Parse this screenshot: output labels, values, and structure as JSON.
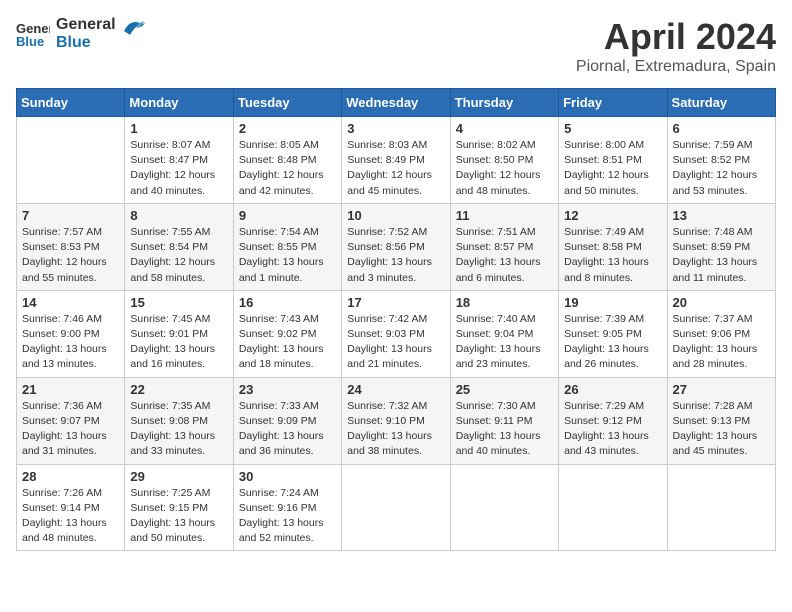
{
  "header": {
    "logo_general": "General",
    "logo_blue": "Blue",
    "title": "April 2024",
    "location": "Piornal, Extremadura, Spain"
  },
  "columns": [
    "Sunday",
    "Monday",
    "Tuesday",
    "Wednesday",
    "Thursday",
    "Friday",
    "Saturday"
  ],
  "weeks": [
    [
      {
        "day": "",
        "info": ""
      },
      {
        "day": "1",
        "info": "Sunrise: 8:07 AM\nSunset: 8:47 PM\nDaylight: 12 hours\nand 40 minutes."
      },
      {
        "day": "2",
        "info": "Sunrise: 8:05 AM\nSunset: 8:48 PM\nDaylight: 12 hours\nand 42 minutes."
      },
      {
        "day": "3",
        "info": "Sunrise: 8:03 AM\nSunset: 8:49 PM\nDaylight: 12 hours\nand 45 minutes."
      },
      {
        "day": "4",
        "info": "Sunrise: 8:02 AM\nSunset: 8:50 PM\nDaylight: 12 hours\nand 48 minutes."
      },
      {
        "day": "5",
        "info": "Sunrise: 8:00 AM\nSunset: 8:51 PM\nDaylight: 12 hours\nand 50 minutes."
      },
      {
        "day": "6",
        "info": "Sunrise: 7:59 AM\nSunset: 8:52 PM\nDaylight: 12 hours\nand 53 minutes."
      }
    ],
    [
      {
        "day": "7",
        "info": "Sunrise: 7:57 AM\nSunset: 8:53 PM\nDaylight: 12 hours\nand 55 minutes."
      },
      {
        "day": "8",
        "info": "Sunrise: 7:55 AM\nSunset: 8:54 PM\nDaylight: 12 hours\nand 58 minutes."
      },
      {
        "day": "9",
        "info": "Sunrise: 7:54 AM\nSunset: 8:55 PM\nDaylight: 13 hours\nand 1 minute."
      },
      {
        "day": "10",
        "info": "Sunrise: 7:52 AM\nSunset: 8:56 PM\nDaylight: 13 hours\nand 3 minutes."
      },
      {
        "day": "11",
        "info": "Sunrise: 7:51 AM\nSunset: 8:57 PM\nDaylight: 13 hours\nand 6 minutes."
      },
      {
        "day": "12",
        "info": "Sunrise: 7:49 AM\nSunset: 8:58 PM\nDaylight: 13 hours\nand 8 minutes."
      },
      {
        "day": "13",
        "info": "Sunrise: 7:48 AM\nSunset: 8:59 PM\nDaylight: 13 hours\nand 11 minutes."
      }
    ],
    [
      {
        "day": "14",
        "info": "Sunrise: 7:46 AM\nSunset: 9:00 PM\nDaylight: 13 hours\nand 13 minutes."
      },
      {
        "day": "15",
        "info": "Sunrise: 7:45 AM\nSunset: 9:01 PM\nDaylight: 13 hours\nand 16 minutes."
      },
      {
        "day": "16",
        "info": "Sunrise: 7:43 AM\nSunset: 9:02 PM\nDaylight: 13 hours\nand 18 minutes."
      },
      {
        "day": "17",
        "info": "Sunrise: 7:42 AM\nSunset: 9:03 PM\nDaylight: 13 hours\nand 21 minutes."
      },
      {
        "day": "18",
        "info": "Sunrise: 7:40 AM\nSunset: 9:04 PM\nDaylight: 13 hours\nand 23 minutes."
      },
      {
        "day": "19",
        "info": "Sunrise: 7:39 AM\nSunset: 9:05 PM\nDaylight: 13 hours\nand 26 minutes."
      },
      {
        "day": "20",
        "info": "Sunrise: 7:37 AM\nSunset: 9:06 PM\nDaylight: 13 hours\nand 28 minutes."
      }
    ],
    [
      {
        "day": "21",
        "info": "Sunrise: 7:36 AM\nSunset: 9:07 PM\nDaylight: 13 hours\nand 31 minutes."
      },
      {
        "day": "22",
        "info": "Sunrise: 7:35 AM\nSunset: 9:08 PM\nDaylight: 13 hours\nand 33 minutes."
      },
      {
        "day": "23",
        "info": "Sunrise: 7:33 AM\nSunset: 9:09 PM\nDaylight: 13 hours\nand 36 minutes."
      },
      {
        "day": "24",
        "info": "Sunrise: 7:32 AM\nSunset: 9:10 PM\nDaylight: 13 hours\nand 38 minutes."
      },
      {
        "day": "25",
        "info": "Sunrise: 7:30 AM\nSunset: 9:11 PM\nDaylight: 13 hours\nand 40 minutes."
      },
      {
        "day": "26",
        "info": "Sunrise: 7:29 AM\nSunset: 9:12 PM\nDaylight: 13 hours\nand 43 minutes."
      },
      {
        "day": "27",
        "info": "Sunrise: 7:28 AM\nSunset: 9:13 PM\nDaylight: 13 hours\nand 45 minutes."
      }
    ],
    [
      {
        "day": "28",
        "info": "Sunrise: 7:26 AM\nSunset: 9:14 PM\nDaylight: 13 hours\nand 48 minutes."
      },
      {
        "day": "29",
        "info": "Sunrise: 7:25 AM\nSunset: 9:15 PM\nDaylight: 13 hours\nand 50 minutes."
      },
      {
        "day": "30",
        "info": "Sunrise: 7:24 AM\nSunset: 9:16 PM\nDaylight: 13 hours\nand 52 minutes."
      },
      {
        "day": "",
        "info": ""
      },
      {
        "day": "",
        "info": ""
      },
      {
        "day": "",
        "info": ""
      },
      {
        "day": "",
        "info": ""
      }
    ]
  ]
}
